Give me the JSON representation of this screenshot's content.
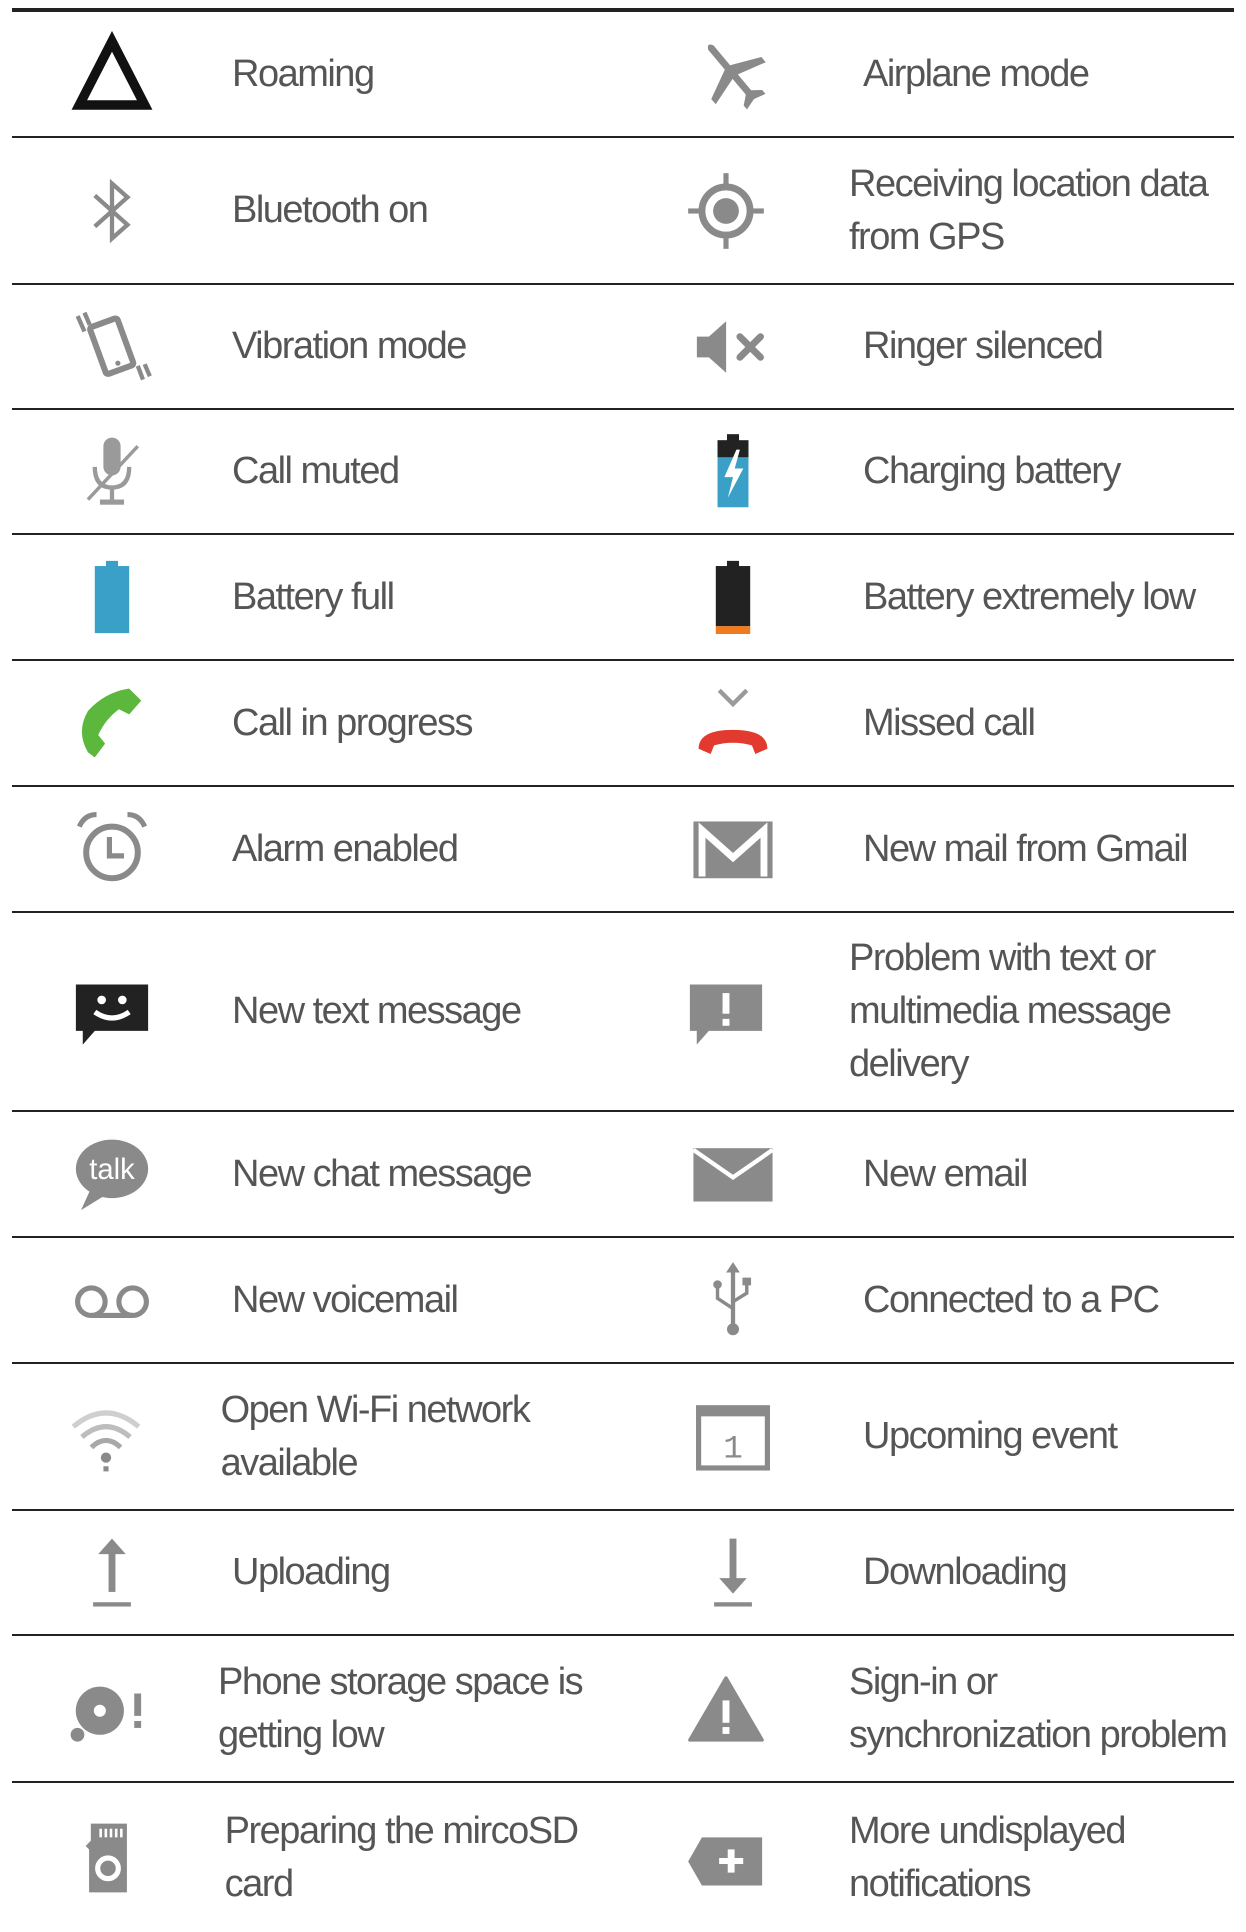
{
  "rows": [
    {
      "left": {
        "icon": "roaming-icon",
        "label": "Roaming"
      },
      "right": {
        "icon": "airplane-icon",
        "label": "Airplane mode"
      }
    },
    {
      "left": {
        "icon": "bluetooth-icon",
        "label": "Bluetooth on"
      },
      "right": {
        "icon": "gps-icon",
        "label": "Receiving location data from GPS"
      }
    },
    {
      "left": {
        "icon": "vibration-icon",
        "label": "Vibration mode"
      },
      "right": {
        "icon": "ringer-silenced-icon",
        "label": "Ringer silenced"
      }
    },
    {
      "left": {
        "icon": "mic-muted-icon",
        "label": "Call muted"
      },
      "right": {
        "icon": "charging-battery-icon",
        "label": "Charging battery"
      }
    },
    {
      "left": {
        "icon": "battery-full-icon",
        "label": "Battery full"
      },
      "right": {
        "icon": "battery-low-icon",
        "label": "Battery extremely low"
      }
    },
    {
      "left": {
        "icon": "call-in-progress-icon",
        "label": "Call in progress"
      },
      "right": {
        "icon": "missed-call-icon",
        "label": "Missed call"
      }
    },
    {
      "left": {
        "icon": "alarm-icon",
        "label": "Alarm enabled"
      },
      "right": {
        "icon": "gmail-icon",
        "label": "New mail from Gmail"
      }
    },
    {
      "left": {
        "icon": "text-message-icon",
        "label": "New text message"
      },
      "right": {
        "icon": "message-error-icon",
        "label": "Problem with text or multimedia message delivery"
      }
    },
    {
      "left": {
        "icon": "talk-icon",
        "label": "New chat message",
        "icon_text": "talk"
      },
      "right": {
        "icon": "email-icon",
        "label": "New email"
      }
    },
    {
      "left": {
        "icon": "voicemail-icon",
        "label": "New voicemail"
      },
      "right": {
        "icon": "usb-icon",
        "label": "Connected to a PC"
      }
    },
    {
      "left": {
        "icon": "wifi-icon",
        "label": "Open Wi-Fi network available"
      },
      "right": {
        "icon": "calendar-icon",
        "label": "Upcoming event",
        "icon_text": "1"
      }
    },
    {
      "left": {
        "icon": "upload-icon",
        "label": "Uploading"
      },
      "right": {
        "icon": "download-icon",
        "label": "Downloading"
      }
    },
    {
      "left": {
        "icon": "storage-low-icon",
        "label": "Phone storage space is getting low"
      },
      "right": {
        "icon": "sync-problem-icon",
        "label": "Sign-in or synchronization problem"
      }
    },
    {
      "left": {
        "icon": "sdcard-icon",
        "label": "Preparing the mircoSD card"
      },
      "right": {
        "icon": "more-notifications-icon",
        "label": "More undisplayed notifications"
      }
    }
  ],
  "colors": {
    "gray": "#8a8a8a",
    "dark": "#222222",
    "blue": "#3aa0c8",
    "green": "#5cb83c",
    "red": "#e23a2e",
    "orange": "#f07a1c",
    "text": "#555555"
  }
}
